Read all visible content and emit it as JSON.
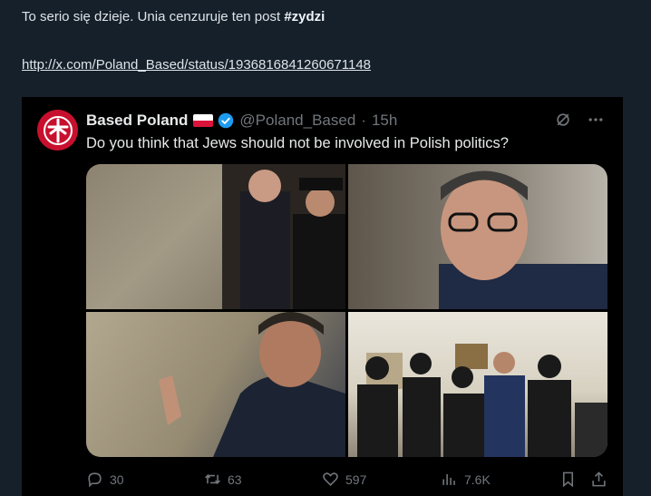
{
  "post": {
    "text": "To serio się dzieje. Unia cenzuruje ten post ",
    "hashtag": "#zydzi",
    "link": "http://x.com/Poland_Based/status/1936816841260671148"
  },
  "tweet": {
    "author_name": "Based Poland",
    "handle": "@Poland_Based",
    "separator": "·",
    "time": "15h",
    "text": "Do you think that Jews should not be involved in Polish politics?",
    "avatar_icon": "eagle-emblem-icon",
    "colors": {
      "avatar_bg": "#c8102e",
      "verified": "#1d9bf0"
    },
    "images": [
      {
        "name": "photo-wall-shush"
      },
      {
        "name": "photo-man-glasses"
      },
      {
        "name": "photo-wall-prayer"
      },
      {
        "name": "photo-group-office"
      }
    ],
    "stats": {
      "replies": "30",
      "reposts": "63",
      "likes": "597",
      "views": "7.6K"
    }
  }
}
